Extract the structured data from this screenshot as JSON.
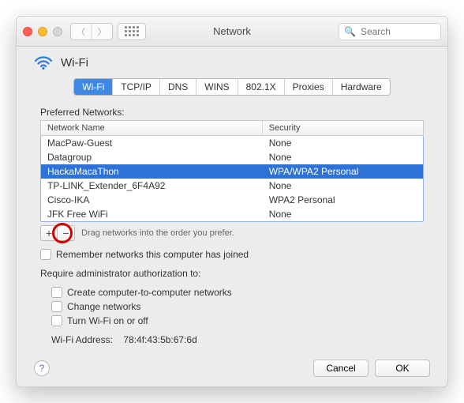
{
  "window": {
    "title": "Network",
    "search_placeholder": "Search"
  },
  "page": {
    "title": "Wi-Fi"
  },
  "tabs": [
    "Wi-Fi",
    "TCP/IP",
    "DNS",
    "WINS",
    "802.1X",
    "Proxies",
    "Hardware"
  ],
  "preferred_label": "Preferred Networks:",
  "columns": {
    "name": "Network Name",
    "security": "Security"
  },
  "networks": [
    {
      "name": "MacPaw-Guest",
      "security": "None",
      "selected": false
    },
    {
      "name": "Datagroup",
      "security": "None",
      "selected": false
    },
    {
      "name": "HackaMacaThon",
      "security": "WPA/WPA2 Personal",
      "selected": true
    },
    {
      "name": "TP-LINK_Extender_6F4A92",
      "security": "None",
      "selected": false
    },
    {
      "name": "Cisco-IKA",
      "security": "WPA2 Personal",
      "selected": false
    },
    {
      "name": "JFK Free WiFi",
      "security": "None",
      "selected": false
    }
  ],
  "drag_hint": "Drag networks into the order you prefer.",
  "remember_label": "Remember networks this computer has joined",
  "admin_label": "Require administrator authorization to:",
  "admin_opts": {
    "create": "Create computer-to-computer networks",
    "change": "Change networks",
    "toggle": "Turn Wi-Fi on or off"
  },
  "wifi_address": {
    "label": "Wi-Fi Address:",
    "value": "78:4f:43:5b:67:6d"
  },
  "buttons": {
    "help": "?",
    "cancel": "Cancel",
    "ok": "OK"
  }
}
